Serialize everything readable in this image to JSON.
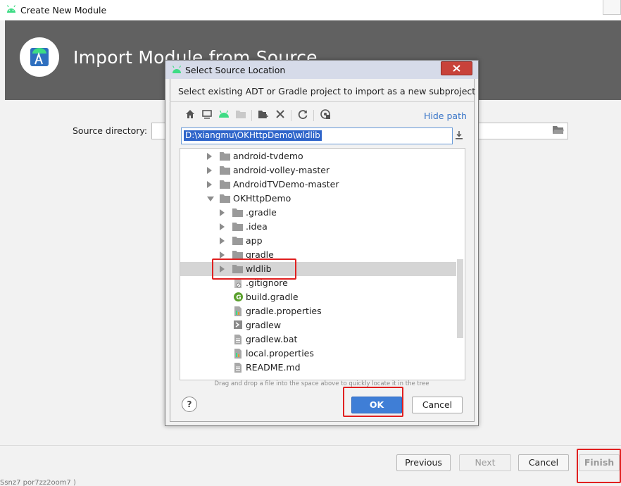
{
  "window": {
    "title": "Create New Module",
    "banner_title": "Import Module from Source",
    "source_directory_label": "Source directory:",
    "source_directory_value": "",
    "buttons": {
      "previous": "Previous",
      "next": "Next",
      "cancel": "Cancel",
      "finish": "Finish"
    },
    "status_text": "Ssnz7 por7zz2oom7 )"
  },
  "dialog": {
    "title": "Select Source Location",
    "description": "Select existing ADT or Gradle project to import as a new subproject",
    "hide_path_label": "Hide path",
    "path_value": "D:\\xiangmu\\OKHttpDemo\\wldlib",
    "tree": [
      {
        "label": "android-tvdemo",
        "type": "folder",
        "expander": "collapsed",
        "level": 0
      },
      {
        "label": "android-volley-master",
        "type": "folder",
        "expander": "collapsed",
        "level": 0
      },
      {
        "label": "AndroidTVDemo-master",
        "type": "folder",
        "expander": "collapsed",
        "level": 0
      },
      {
        "label": "OKHttpDemo",
        "type": "folder",
        "expander": "expanded",
        "level": 0
      },
      {
        "label": ".gradle",
        "type": "folder",
        "expander": "collapsed",
        "level": 1
      },
      {
        "label": ".idea",
        "type": "folder",
        "expander": "collapsed",
        "level": 1
      },
      {
        "label": "app",
        "type": "folder",
        "expander": "collapsed",
        "level": 1
      },
      {
        "label": "gradle",
        "type": "folder",
        "expander": "collapsed",
        "level": 1
      },
      {
        "label": "wldlib",
        "type": "folder",
        "expander": "collapsed",
        "level": 1,
        "selected": true
      },
      {
        "label": ".gitignore",
        "type": "gitignore-file",
        "expander": "none",
        "level": 1
      },
      {
        "label": "build.gradle",
        "type": "gradle-file",
        "expander": "none",
        "level": 1
      },
      {
        "label": "gradle.properties",
        "type": "properties-file",
        "expander": "none",
        "level": 1
      },
      {
        "label": "gradlew",
        "type": "script-file",
        "expander": "none",
        "level": 1
      },
      {
        "label": "gradlew.bat",
        "type": "text-file",
        "expander": "none",
        "level": 1
      },
      {
        "label": "local.properties",
        "type": "properties-file",
        "expander": "none",
        "level": 1
      },
      {
        "label": "README.md",
        "type": "text-file",
        "expander": "none",
        "level": 1
      }
    ],
    "hint": "Drag and drop a file into the space above to quickly locate it in the tree",
    "help_label": "?",
    "ok_label": "OK",
    "cancel_label": "Cancel"
  },
  "colors": {
    "banner": "#616161",
    "accent": "#3f7ed6",
    "highlight": "#e02020",
    "selection": "#2f65ca"
  }
}
